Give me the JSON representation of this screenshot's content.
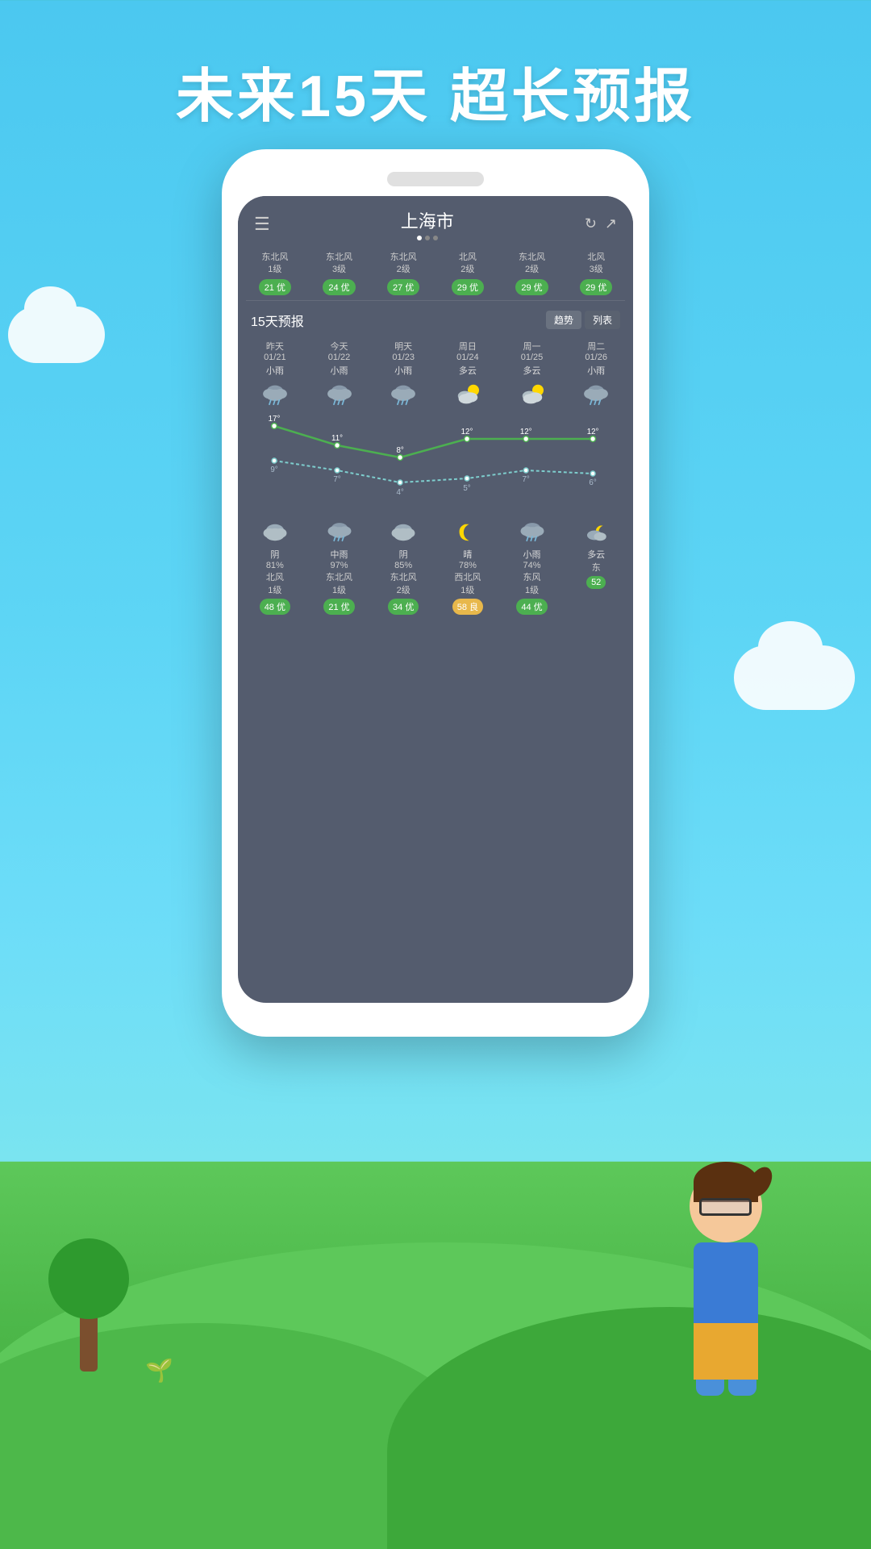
{
  "title": "未来15天 超长预报",
  "background": {
    "sky_color_top": "#4BC8F0",
    "sky_color_bottom": "#7AE4F0",
    "grass_color": "#4DB84A"
  },
  "phone": {
    "city": "上海市",
    "aqi_columns": [
      {
        "wind": "东北风\n1级",
        "aqi": "21 优",
        "type": "good"
      },
      {
        "wind": "东北风\n3级",
        "aqi": "24 优",
        "type": "good"
      },
      {
        "wind": "东北风\n2级",
        "aqi": "27 优",
        "type": "good"
      },
      {
        "wind": "北风\n2级",
        "aqi": "29 优",
        "type": "good"
      },
      {
        "wind": "东北风\n2级",
        "aqi": "29 优",
        "type": "good"
      },
      {
        "wind": "北风\n3级",
        "aqi": "29 优",
        "type": "good"
      }
    ],
    "forecast_title": "15天预报",
    "tabs": [
      "趋势",
      "列表"
    ],
    "days": [
      {
        "label": "昨天",
        "date": "01/21",
        "weather": "小雨",
        "icon": "rain",
        "hi": "17°",
        "lo": "9°"
      },
      {
        "label": "今天",
        "date": "01/22",
        "weather": "小雨",
        "icon": "rain",
        "hi": "11°",
        "lo": "7°"
      },
      {
        "label": "明天",
        "date": "01/23",
        "weather": "小雨",
        "icon": "rain",
        "hi": "8°",
        "lo": "4°"
      },
      {
        "label": "周日",
        "date": "01/24",
        "weather": "多云",
        "icon": "partly",
        "hi": "12°",
        "lo": "5°"
      },
      {
        "label": "周一",
        "date": "01/25",
        "weather": "多云",
        "icon": "partly",
        "hi": "12°",
        "lo": "7°"
      },
      {
        "label": "周二",
        "date": "01/26",
        "weather": "小雨",
        "icon": "rain",
        "hi": "12°",
        "lo": "6°"
      }
    ],
    "bottom_days": [
      {
        "icon": "cloud",
        "condition": "阴",
        "humidity": "81%",
        "wind": "北风\n1级",
        "aqi": "48 优",
        "aqi_type": "good"
      },
      {
        "icon": "rain",
        "condition": "中雨",
        "humidity": "97%",
        "wind": "东北风\n1级",
        "aqi": "21 优",
        "aqi_type": "good"
      },
      {
        "icon": "cloud",
        "condition": "阴",
        "humidity": "85%",
        "wind": "东北风\n2级",
        "aqi": "34 优",
        "aqi_type": "good"
      },
      {
        "icon": "moon",
        "condition": "晴",
        "humidity": "78%",
        "wind": "西北风\n1级",
        "aqi": "58 良",
        "aqi_type": "liang"
      },
      {
        "icon": "rain-cloud",
        "condition": "小雨",
        "humidity": "74%",
        "wind": "东风\n1级",
        "aqi": "44 优",
        "aqi_type": "good"
      },
      {
        "icon": "cloud-moon",
        "condition": "多云",
        "humidity": "",
        "wind": "东\n",
        "aqi": "52",
        "aqi_type": "good"
      }
    ]
  }
}
